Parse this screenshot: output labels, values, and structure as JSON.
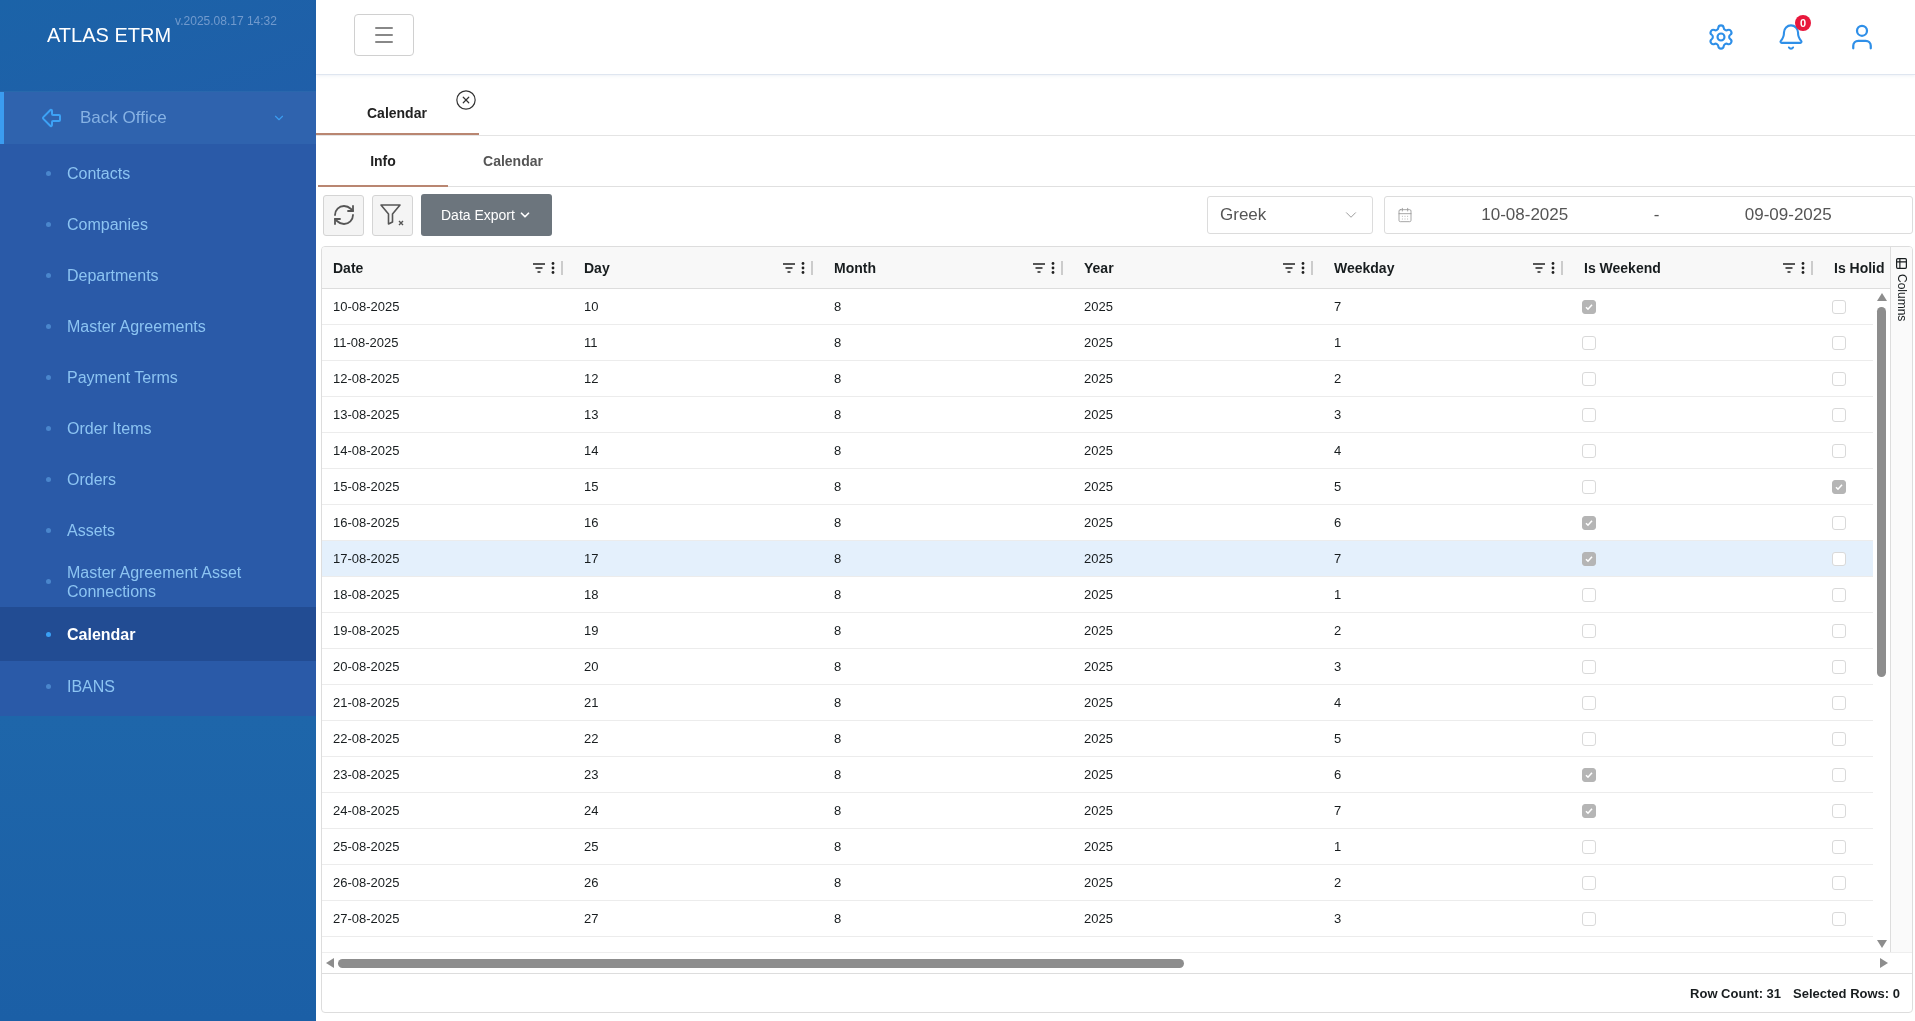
{
  "app": {
    "title": "ATLAS ETRM",
    "version": "v.2025.08.17 14:32"
  },
  "header": {
    "notifications": "0"
  },
  "sidebar": {
    "group": {
      "label": "Back Office",
      "expanded": true,
      "children": [
        {
          "label": "Contacts",
          "selected": false
        },
        {
          "label": "Companies",
          "selected": false
        },
        {
          "label": "Departments",
          "selected": false
        },
        {
          "label": "Master Agreements",
          "selected": false
        },
        {
          "label": "Payment Terms",
          "selected": false
        },
        {
          "label": "Order Items",
          "selected": false
        },
        {
          "label": "Orders",
          "selected": false
        },
        {
          "label": "Assets",
          "selected": false
        },
        {
          "label": "Master Agreement Asset Connections",
          "selected": false
        },
        {
          "label": "Calendar",
          "selected": true
        },
        {
          "label": "IBANS",
          "selected": false
        }
      ]
    }
  },
  "document_tabs": [
    {
      "label": "Calendar",
      "selected": true
    }
  ],
  "tabs": [
    {
      "label": "Info",
      "selected": true
    },
    {
      "label": "Calendar",
      "selected": false
    }
  ],
  "toolbar": {
    "export_label": "Data Export",
    "calendar_select": "Greek",
    "date_from": "10-08-2025",
    "date_separator": "-",
    "date_to": "09-09-2025"
  },
  "table": {
    "columns": [
      "Date",
      "Day",
      "Month",
      "Year",
      "Weekday",
      "Is Weekend",
      "Is Holid"
    ],
    "side_panel": "Columns",
    "rows": [
      {
        "date": "10-08-2025",
        "day": "10",
        "month": "8",
        "year": "2025",
        "weekday": "7",
        "is_weekend": true,
        "is_holiday": false,
        "hovered": false
      },
      {
        "date": "11-08-2025",
        "day": "11",
        "month": "8",
        "year": "2025",
        "weekday": "1",
        "is_weekend": false,
        "is_holiday": false,
        "hovered": false
      },
      {
        "date": "12-08-2025",
        "day": "12",
        "month": "8",
        "year": "2025",
        "weekday": "2",
        "is_weekend": false,
        "is_holiday": false,
        "hovered": false
      },
      {
        "date": "13-08-2025",
        "day": "13",
        "month": "8",
        "year": "2025",
        "weekday": "3",
        "is_weekend": false,
        "is_holiday": false,
        "hovered": false
      },
      {
        "date": "14-08-2025",
        "day": "14",
        "month": "8",
        "year": "2025",
        "weekday": "4",
        "is_weekend": false,
        "is_holiday": false,
        "hovered": false
      },
      {
        "date": "15-08-2025",
        "day": "15",
        "month": "8",
        "year": "2025",
        "weekday": "5",
        "is_weekend": false,
        "is_holiday": true,
        "hovered": false
      },
      {
        "date": "16-08-2025",
        "day": "16",
        "month": "8",
        "year": "2025",
        "weekday": "6",
        "is_weekend": true,
        "is_holiday": false,
        "hovered": false
      },
      {
        "date": "17-08-2025",
        "day": "17",
        "month": "8",
        "year": "2025",
        "weekday": "7",
        "is_weekend": true,
        "is_holiday": false,
        "hovered": true
      },
      {
        "date": "18-08-2025",
        "day": "18",
        "month": "8",
        "year": "2025",
        "weekday": "1",
        "is_weekend": false,
        "is_holiday": false,
        "hovered": false
      },
      {
        "date": "19-08-2025",
        "day": "19",
        "month": "8",
        "year": "2025",
        "weekday": "2",
        "is_weekend": false,
        "is_holiday": false,
        "hovered": false
      },
      {
        "date": "20-08-2025",
        "day": "20",
        "month": "8",
        "year": "2025",
        "weekday": "3",
        "is_weekend": false,
        "is_holiday": false,
        "hovered": false
      },
      {
        "date": "21-08-2025",
        "day": "21",
        "month": "8",
        "year": "2025",
        "weekday": "4",
        "is_weekend": false,
        "is_holiday": false,
        "hovered": false
      },
      {
        "date": "22-08-2025",
        "day": "22",
        "month": "8",
        "year": "2025",
        "weekday": "5",
        "is_weekend": false,
        "is_holiday": false,
        "hovered": false
      },
      {
        "date": "23-08-2025",
        "day": "23",
        "month": "8",
        "year": "2025",
        "weekday": "6",
        "is_weekend": true,
        "is_holiday": false,
        "hovered": false
      },
      {
        "date": "24-08-2025",
        "day": "24",
        "month": "8",
        "year": "2025",
        "weekday": "7",
        "is_weekend": true,
        "is_holiday": false,
        "hovered": false
      },
      {
        "date": "25-08-2025",
        "day": "25",
        "month": "8",
        "year": "2025",
        "weekday": "1",
        "is_weekend": false,
        "is_holiday": false,
        "hovered": false
      },
      {
        "date": "26-08-2025",
        "day": "26",
        "month": "8",
        "year": "2025",
        "weekday": "2",
        "is_weekend": false,
        "is_holiday": false,
        "hovered": false
      },
      {
        "date": "27-08-2025",
        "day": "27",
        "month": "8",
        "year": "2025",
        "weekday": "3",
        "is_weekend": false,
        "is_holiday": false,
        "hovered": false
      }
    ],
    "footer": {
      "row_count": "Row Count: 31",
      "selected_rows": "Selected Rows: 0"
    }
  }
}
